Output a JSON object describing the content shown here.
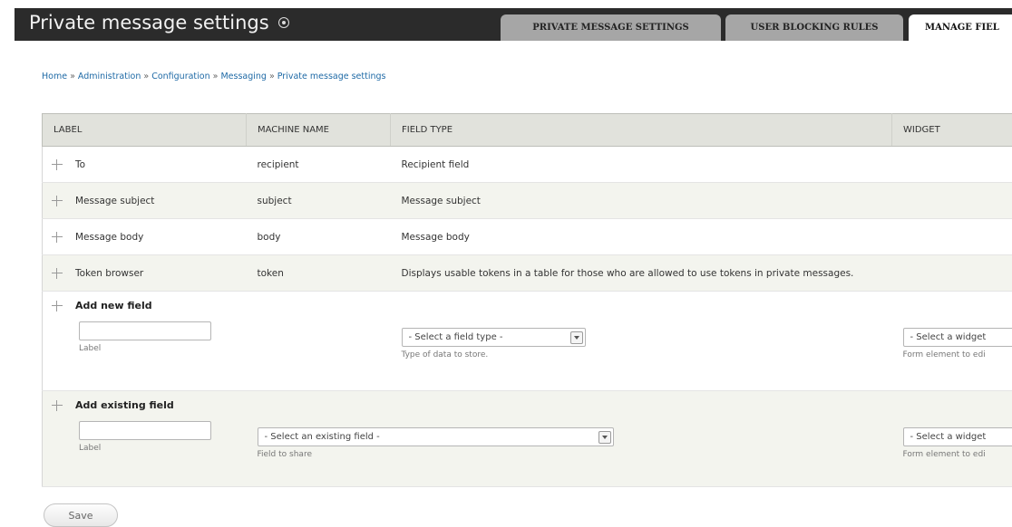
{
  "header": {
    "title": "Private message settings",
    "tabs": [
      {
        "label": "PRIVATE MESSAGE SETTINGS",
        "active": false
      },
      {
        "label": "USER BLOCKING RULES",
        "active": false
      },
      {
        "label": "MANAGE FIEL",
        "active": true
      }
    ]
  },
  "breadcrumb": [
    "Home",
    "Administration",
    "Configuration",
    "Messaging",
    "Private message settings"
  ],
  "breadcrumb_separator": "»",
  "table": {
    "columns": [
      "LABEL",
      "MACHINE NAME",
      "FIELD TYPE",
      "WIDGET"
    ],
    "rows": [
      {
        "label": "To",
        "machine_name": "recipient",
        "field_type": "Recipient field",
        "widget": ""
      },
      {
        "label": "Message subject",
        "machine_name": "subject",
        "field_type": "Message subject",
        "widget": ""
      },
      {
        "label": "Message body",
        "machine_name": "body",
        "field_type": "Message body",
        "widget": ""
      },
      {
        "label": "Token browser",
        "machine_name": "token",
        "field_type": "Displays usable tokens in a table for those who are allowed to use tokens in private messages.",
        "widget": ""
      }
    ],
    "add_new": {
      "title": "Add new field",
      "label_value": "",
      "label_desc": "Label",
      "type_select": "- Select a field type -",
      "type_desc": "Type of data to store.",
      "widget_select": "- Select a widget",
      "widget_desc": "Form element to edi"
    },
    "add_existing": {
      "title": "Add existing field",
      "label_value": "",
      "label_desc": "Label",
      "field_select": "- Select an existing field -",
      "field_desc": "Field to share",
      "widget_select": "- Select a widget",
      "widget_desc": "Form element to edi"
    }
  },
  "actions": {
    "save_label": "Save"
  },
  "colors": {
    "header_bg": "#2b2b2b",
    "tab_bg": "#a6a6a6",
    "link": "#1f6aa6",
    "row_alt": "#f3f4ee",
    "table_head": "#e1e2dc"
  }
}
